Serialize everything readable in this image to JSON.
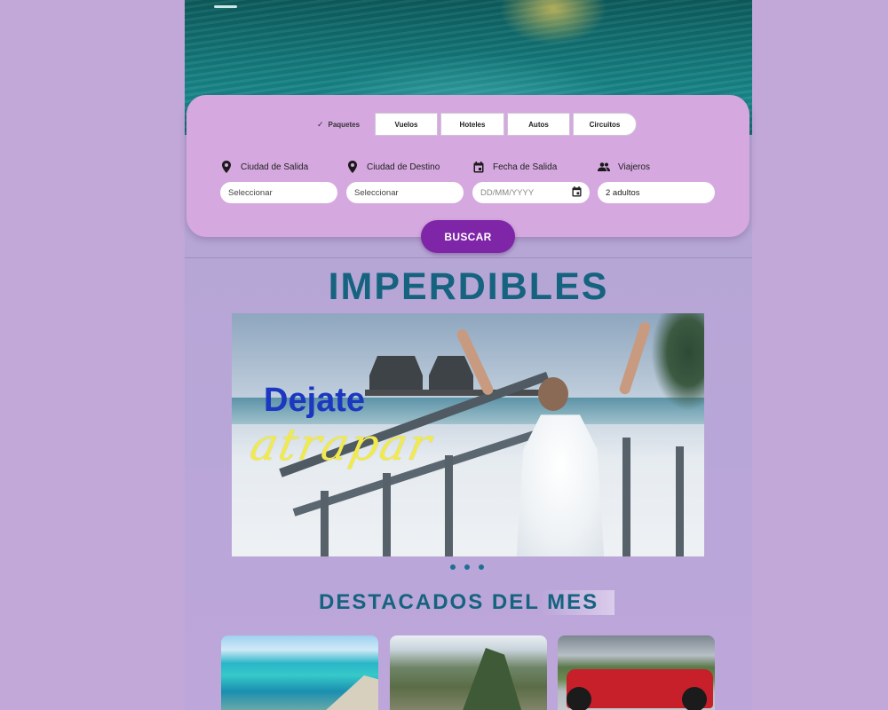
{
  "search": {
    "tabs": [
      {
        "label": "Paquetes",
        "active": true
      },
      {
        "label": "Vuelos",
        "active": false
      },
      {
        "label": "Hoteles",
        "active": false
      },
      {
        "label": "Autos",
        "active": false
      },
      {
        "label": "Circuitos",
        "active": false
      }
    ],
    "fields": {
      "origin": {
        "label": "Ciudad de Salida",
        "value": "Seleccionar",
        "icon": "location-pin-icon"
      },
      "destination": {
        "label": "Ciudad de Destino",
        "value": "Seleccionar",
        "icon": "location-pin-icon"
      },
      "date": {
        "label": "Fecha de Salida",
        "placeholder": "DD/MM/YYYY",
        "icon": "calendar-icon"
      },
      "travelers": {
        "label": "Viajeros",
        "value": "2 adultos",
        "icon": "people-icon"
      }
    },
    "button_label": "BUSCAR"
  },
  "imperdibles": {
    "title": "IMPERDIBLES",
    "banner": {
      "headline": "Dejate",
      "script_text": "atrapar"
    },
    "slide_count": 3
  },
  "destacados": {
    "title": "DESTACADOS DEL MES",
    "cards": [
      {
        "image": "island-coast"
      },
      {
        "image": "machu-picchu"
      },
      {
        "image": "formula-one-car"
      }
    ]
  },
  "colors": {
    "page_bg": "#c1a8d8",
    "card_bg": "#d5a8df",
    "button": "#7f25a7",
    "title": "#16637f",
    "headline_blue": "#1c37c0",
    "script_yellow": "#f1ea4f"
  }
}
